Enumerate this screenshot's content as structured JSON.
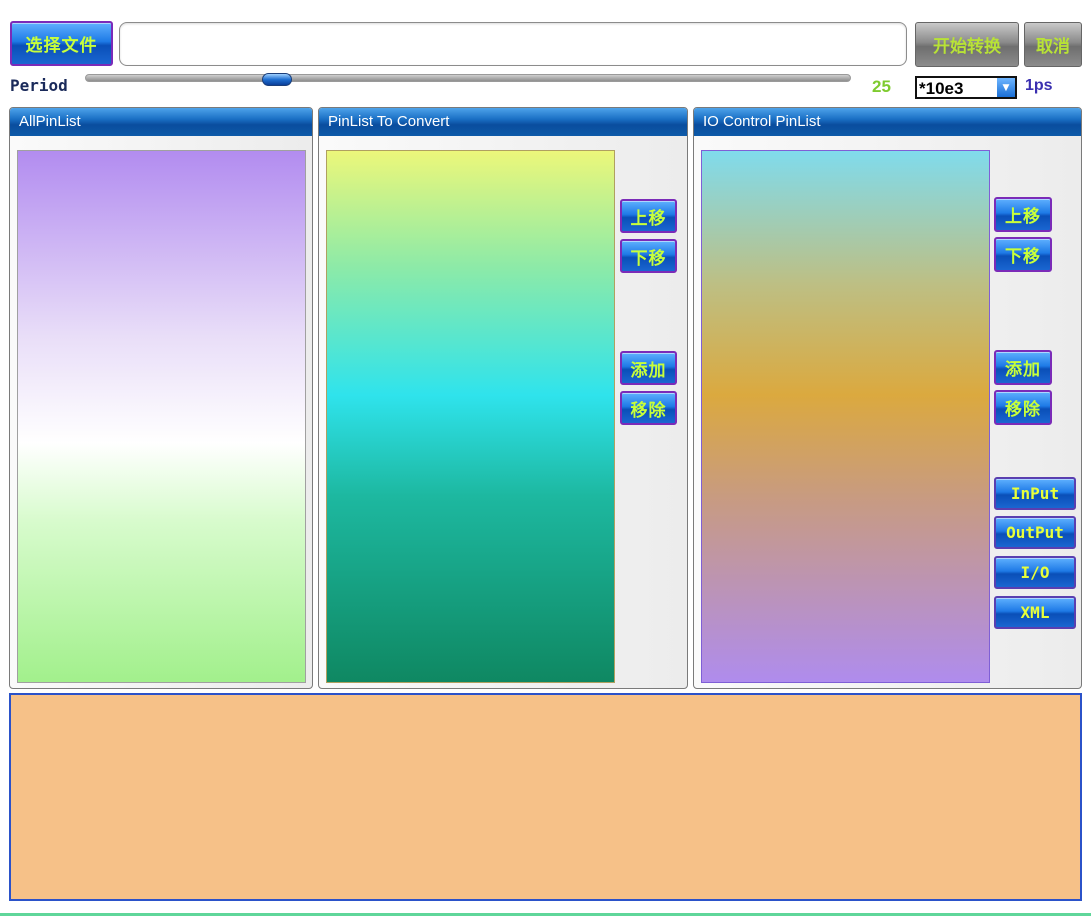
{
  "toolbar": {
    "select_file_label": "选择文件",
    "file_path_value": "",
    "start_convert_label": "开始转换",
    "cancel_label": "取消"
  },
  "period": {
    "label": "Period",
    "value": "25",
    "slider_value": 25,
    "multiplier_selected": "*10e3",
    "unit": "1ps"
  },
  "panels": {
    "all_pins": {
      "title": "AllPinList",
      "items": []
    },
    "pins_to_convert": {
      "title": "PinList To Convert",
      "items": [],
      "move_up_label": "上移",
      "move_down_label": "下移",
      "add_label": "添加",
      "remove_label": "移除"
    },
    "io_control": {
      "title": "IO Control PinList",
      "items": [],
      "move_up_label": "上移",
      "move_down_label": "下移",
      "add_label": "添加",
      "remove_label": "移除",
      "input_label": "InPut",
      "output_label": "OutPut",
      "io_label": "I/O",
      "xml_label": "XML"
    }
  },
  "log": {
    "text": ""
  },
  "colors": {
    "button_text": "#c8ff3a",
    "button_border": "#7b2bb8",
    "header_blue": "#0a4d9e",
    "log_background": "#f6c188",
    "log_border": "#2b52c9",
    "period_value": "#7ecb2f",
    "unit_text": "#3a2fb0"
  }
}
